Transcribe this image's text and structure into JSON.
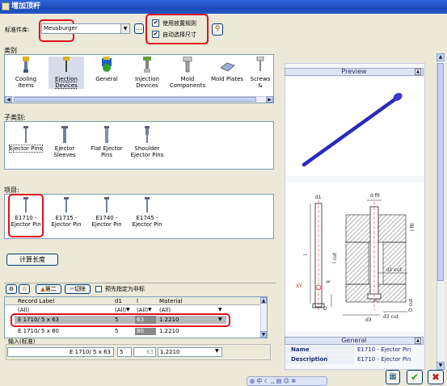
{
  "window": {
    "title": "增加顶杆"
  },
  "library": {
    "label": "标准件库:",
    "value": "Meusburger"
  },
  "options": {
    "use_placement_rules": "使用放置规则",
    "auto_select_size": "自动选择尺寸"
  },
  "category": {
    "label": "类别",
    "items": [
      {
        "label": "Cooling Items"
      },
      {
        "label": "Ejection Devices"
      },
      {
        "label": "General"
      },
      {
        "label": "Injection Devices"
      },
      {
        "label": "Mold Components"
      },
      {
        "label": "Mold Plates"
      },
      {
        "label": "Screws &"
      }
    ]
  },
  "subcategory": {
    "label": "子类别:",
    "items": [
      {
        "label": "Ejector Pins"
      },
      {
        "label": "Ejector Sleeves"
      },
      {
        "label": "Flat Ejector Pins"
      },
      {
        "label": "Shoulder Ejector Pins"
      }
    ]
  },
  "project": {
    "label": "项目:",
    "items": [
      {
        "label": "E1710 - Ejector Pin"
      },
      {
        "label": "E1715 - Ejector Pin"
      },
      {
        "label": "E1740 - Ejector Pin"
      },
      {
        "label": "E1745 - Ejector Pin"
      }
    ]
  },
  "calc_length_button": "计算长度",
  "table_toolbar": {
    "second": "第二",
    "trim": "切除",
    "default_unselected": "预先指定为非标"
  },
  "table": {
    "columns": [
      "Record Label",
      "d1",
      "l",
      "Material"
    ],
    "filter_row": [
      "(All)",
      "(All)",
      "(All)",
      "(All)"
    ],
    "rows": [
      [
        "E 1710/ 5 x 63",
        "5",
        "63",
        "1.2210"
      ],
      [
        "E 1710/ 5 x 80",
        "5",
        "80",
        "1.2210"
      ]
    ]
  },
  "input": {
    "label": "输入(标准)",
    "record": "E 1710/ 5 x 63",
    "d1": "5",
    "l": "63",
    "material": "1.2210"
  },
  "preview": {
    "title": "Preview"
  },
  "drawing_labels": [
    "d1",
    "d fit",
    "l fit",
    "l",
    "d1 cut",
    "l cut",
    "k",
    "D",
    "d3",
    "d3 cut",
    "D cut",
    "XY"
  ],
  "general": {
    "title": "General",
    "rows": [
      {
        "key": "Name",
        "value": "E1710 - Ejector Pin"
      },
      {
        "key": "Description",
        "value": "E1710 - Ejector Pin"
      }
    ]
  },
  "colors": {
    "accent_red": "#e01020",
    "title_blue": "#1b4ab8",
    "pin_blue": "#3a3ac8",
    "selected_row": "#b8b8b8"
  }
}
